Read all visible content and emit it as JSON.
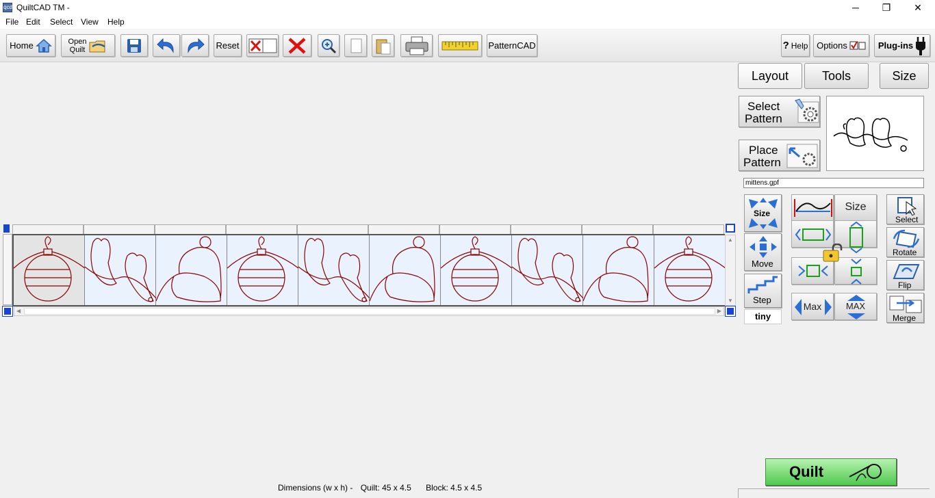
{
  "window": {
    "title": "QuiltCAD TM -",
    "icon_label": "qcd",
    "minimize": "─",
    "maximize": "❐",
    "close": "✕"
  },
  "menu": [
    "File",
    "Edit",
    "Select",
    "View",
    "Help"
  ],
  "toolbar": {
    "home": "Home",
    "open_quilt_line1": "Open",
    "open_quilt_line2": "Quilt",
    "reset": "Reset",
    "patterncad": "PatternCAD",
    "help": "Help",
    "help_q": "?",
    "options": "Options",
    "plugins": "Plug-ins"
  },
  "panel": {
    "tabs": {
      "layout": "Layout",
      "tools": "Tools",
      "size": "Size"
    },
    "select_pattern_1": "Select",
    "select_pattern_2": "Pattern",
    "place_pattern_1": "Place",
    "place_pattern_2": "Pattern",
    "pattern_file": "mittens.gpf",
    "size_mode": "Size",
    "move": "Move",
    "step": "Step",
    "step_value": "tiny",
    "size_btn": "Size",
    "max": "Max",
    "max_caps": "MAX",
    "select": "Select",
    "rotate": "Rotate",
    "flip": "Flip",
    "merge": "Merge",
    "quilt": "Quilt"
  },
  "canvas": {
    "blocks": [
      "ornament",
      "mittens",
      "hat",
      "ornament",
      "mittens",
      "hat",
      "ornament",
      "mittens",
      "hat",
      "ornament"
    ],
    "selected_block": 0
  },
  "status": {
    "dimensions_label": "Dimensions (w x h) -",
    "quilt_label": "Quilt:",
    "quilt_value": "45 x 4.5",
    "block_label": "Block:",
    "block_value": "4.5 x 4.5"
  },
  "colors": {
    "pattern_stroke": "#8b0000",
    "block_bg": "#eaf2fd",
    "quilt_green": "#5fd35f",
    "accent_blue": "#2b6fd6"
  }
}
